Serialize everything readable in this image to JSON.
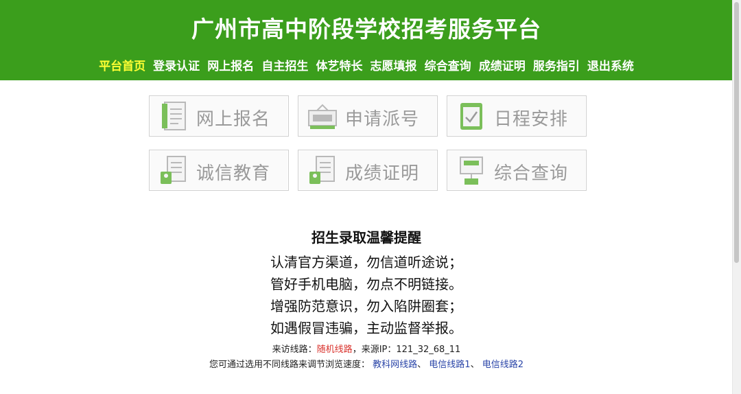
{
  "header": {
    "title": "广州市高中阶段学校招考服务平台",
    "nav": [
      "平台首页",
      "登录认证",
      "网上报名",
      "自主招生",
      "体艺特长",
      "志愿填报",
      "综合查询",
      "成绩证明",
      "服务指引",
      "退出系统"
    ],
    "active_index": 0
  },
  "tiles": [
    {
      "label": "网上报名",
      "icon": "form-icon"
    },
    {
      "label": "申请派号",
      "icon": "ticket-icon"
    },
    {
      "label": "日程安排",
      "icon": "schedule-icon"
    },
    {
      "label": "诚信教育",
      "icon": "document-icon"
    },
    {
      "label": "成绩证明",
      "icon": "certificate-icon"
    },
    {
      "label": "综合查询",
      "icon": "query-icon"
    }
  ],
  "notice": {
    "title": "招生录取温馨提醒",
    "lines": [
      "认清官方渠道，勿信道听途说；",
      "管好手机电脑，勿点不明链接。",
      "增强防范意识，勿入陷阱圈套；",
      "如遇假冒违骗，主动监督举报。"
    ]
  },
  "route": {
    "prefix": "来访线路：",
    "current": "随机线路",
    "ip_label": "，来源IP：",
    "ip": "121_32_68_11",
    "hint": "您可通过选用不同线路来调节浏览速度：",
    "options": [
      "教科网线路",
      "电信线路1",
      "电信线路2"
    ],
    "separator": "、"
  },
  "colors": {
    "header_bg": "#3b9e1c",
    "nav_active": "#ffff33",
    "link_red": "#d9322c",
    "link_blue": "#2a45a8"
  }
}
